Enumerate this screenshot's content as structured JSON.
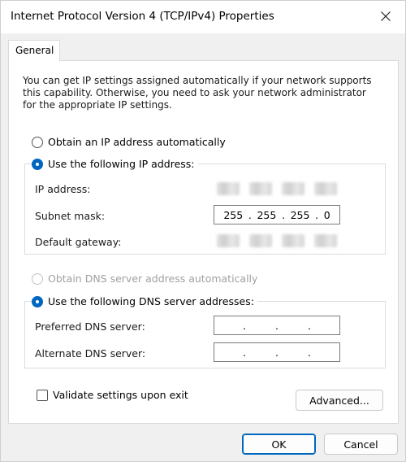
{
  "window": {
    "title": "Internet Protocol Version 4 (TCP/IPv4) Properties"
  },
  "tabs": [
    {
      "label": "General",
      "selected": true
    }
  ],
  "intro_text": "You can get IP settings assigned automatically if your network supports this capability. Otherwise, you need to ask your network administrator for the appropriate IP settings.",
  "ip_section": {
    "obtain_auto_label": "Obtain an IP address automatically",
    "obtain_auto_selected": false,
    "use_following_label": "Use the following IP address:",
    "use_following_selected": true,
    "fields": {
      "ip_address": {
        "label": "IP address:",
        "value": ""
      },
      "subnet_mask": {
        "label": "Subnet mask:",
        "octets": [
          "255",
          "255",
          "255",
          "0"
        ]
      },
      "default_gateway": {
        "label": "Default gateway:",
        "value": ""
      }
    }
  },
  "dns_section": {
    "obtain_auto_label": "Obtain DNS server address automatically",
    "obtain_auto_selected": false,
    "obtain_auto_disabled": true,
    "use_following_label": "Use the following DNS server addresses:",
    "use_following_selected": true,
    "fields": {
      "preferred": {
        "label": "Preferred DNS server:",
        "octets": [
          "",
          "",
          "",
          ""
        ]
      },
      "alternate": {
        "label": "Alternate DNS server:",
        "octets": [
          "",
          "",
          "",
          ""
        ]
      }
    }
  },
  "validate_label": "Validate settings upon exit",
  "validate_checked": false,
  "buttons": {
    "advanced": "Advanced...",
    "ok": "OK",
    "cancel": "Cancel"
  },
  "colors": {
    "accent": "#0067c0"
  },
  "icons": {
    "close": "close-icon"
  }
}
